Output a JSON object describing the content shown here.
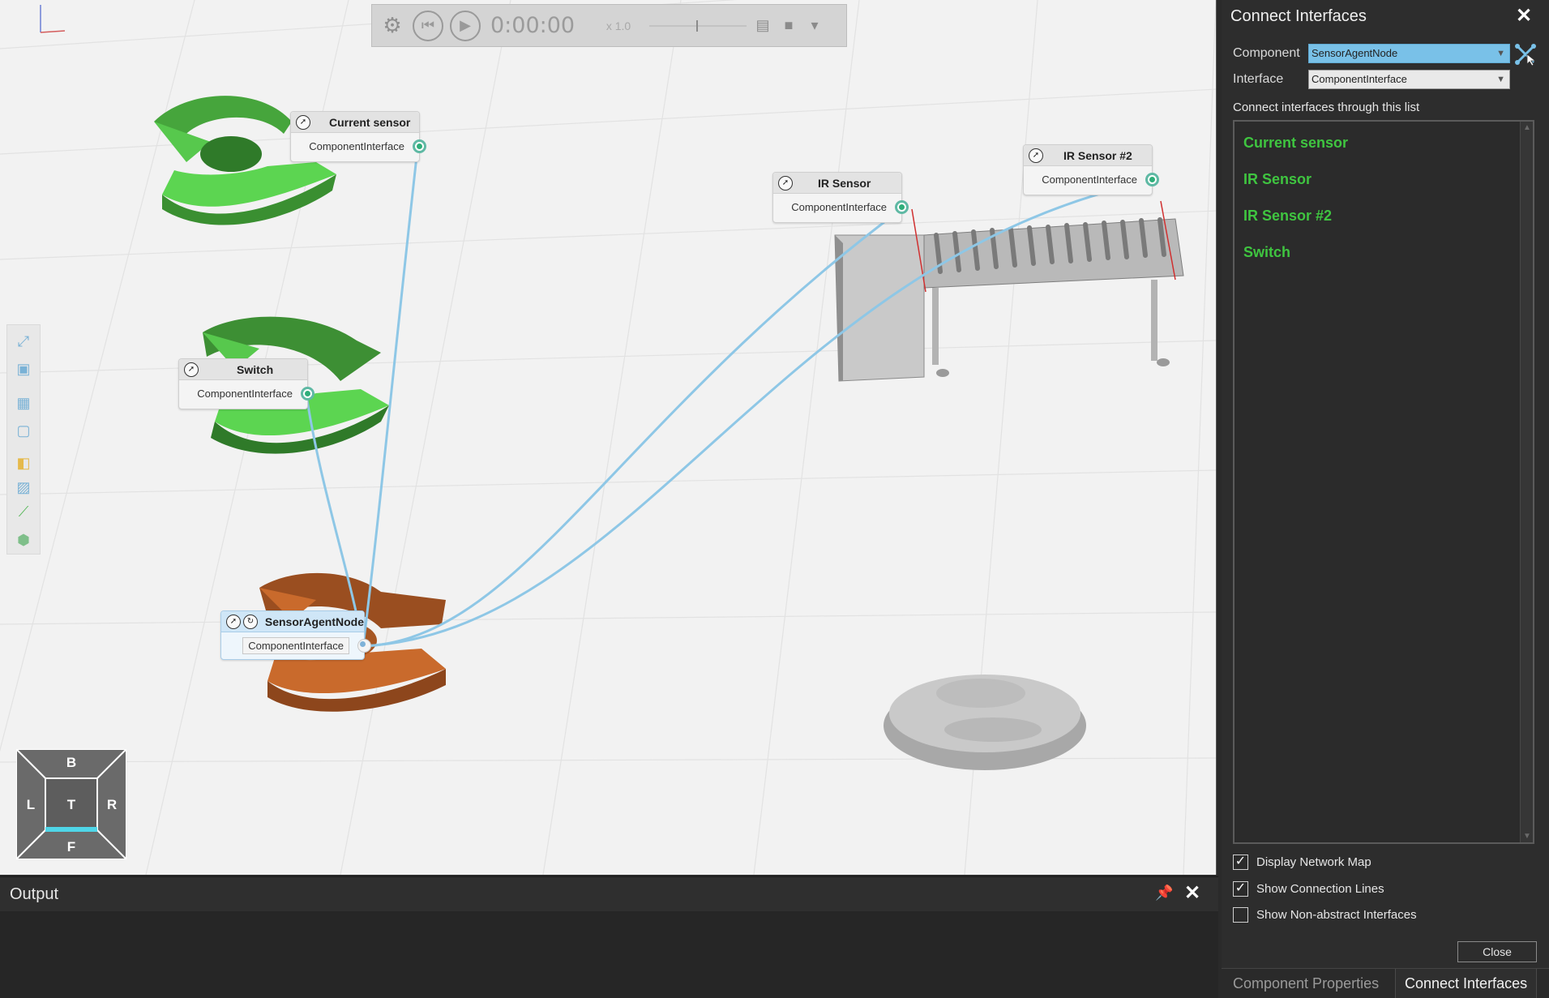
{
  "playback": {
    "time": "0:00:00",
    "speed": "x 1.0"
  },
  "nodes": {
    "current_sensor": {
      "title": "Current sensor",
      "port": "ComponentInterface"
    },
    "switch": {
      "title": "Switch",
      "port": "ComponentInterface"
    },
    "sensor_agent": {
      "title": "SensorAgentNode",
      "port": "ComponentInterface"
    },
    "ir_sensor": {
      "title": "IR Sensor",
      "port": "ComponentInterface"
    },
    "ir_sensor_2": {
      "title": "IR Sensor #2",
      "port": "ComponentInterface"
    }
  },
  "navcube": {
    "top": "B",
    "left": "L",
    "center": "T",
    "right": "R",
    "bottom": "F"
  },
  "panel": {
    "title": "Connect Interfaces",
    "component_label": "Component",
    "component_value": "SensorAgentNode",
    "interface_label": "Interface",
    "interface_value": "ComponentInterface",
    "list_caption": "Connect interfaces through this list",
    "list_items": [
      "Current sensor",
      "IR Sensor",
      "IR Sensor #2",
      "Switch"
    ],
    "checkboxes": [
      {
        "label": "Display Network Map",
        "checked": true
      },
      {
        "label": "Show Connection Lines",
        "checked": true
      },
      {
        "label": "Show Non-abstract Interfaces",
        "checked": false
      }
    ],
    "close_label": "Close",
    "tabs": [
      "Component Properties",
      "Connect Interfaces"
    ],
    "active_tab": "Connect Interfaces"
  },
  "output": {
    "title": "Output"
  },
  "colors": {
    "node_green": "#57c84d",
    "node_orange": "#c96a2c",
    "link_blue": "#8ec7e6",
    "list_green": "#3fc540",
    "combo_active": "#79c1e8"
  }
}
